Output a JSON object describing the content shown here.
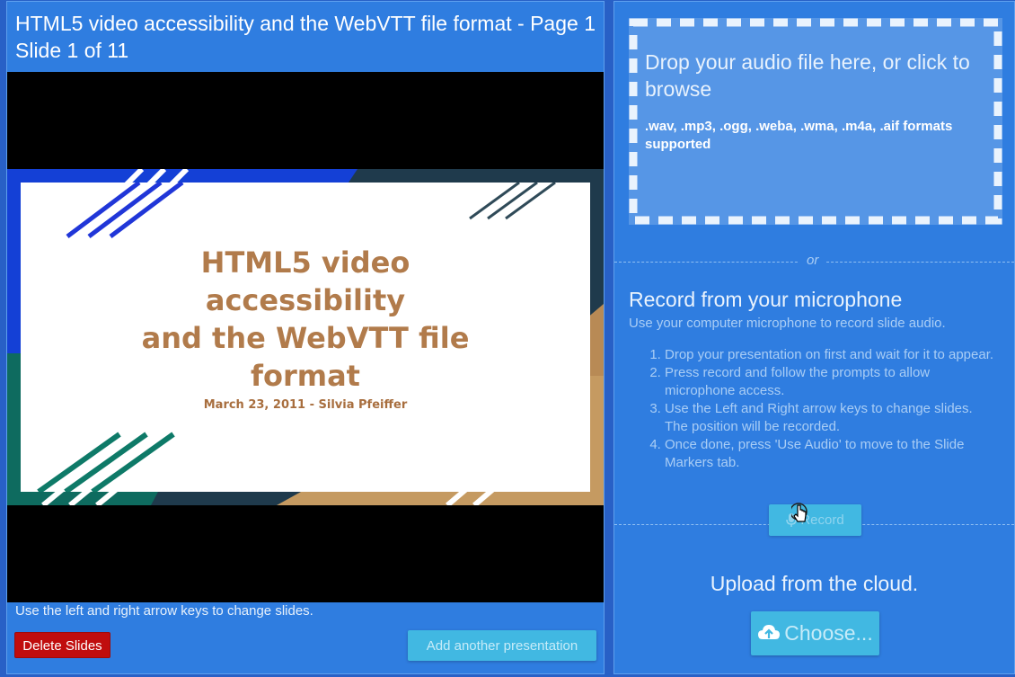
{
  "left": {
    "title": "HTML5 video accessibility and the WebVTT file format - Page 1",
    "counter": "Slide 1 of 11",
    "slide": {
      "heading": "HTML5 video\naccessibility\nand the WebVTT file\nformat",
      "subtitle": "March 23, 2011 - Silvia Pfeiffer"
    },
    "hint": "Use the left and right arrow keys to change slides.",
    "delete_label": "Delete Slides",
    "add_label": "Add another presentation"
  },
  "right": {
    "dropzone": {
      "title": "Drop your audio file here, or click to browse",
      "formats": ".wav, .mp3, .ogg, .weba, .wma, .m4a, .aif formats supported"
    },
    "or_text": "or",
    "record": {
      "title": "Record from your microphone",
      "subtitle": "Use your computer microphone to record slide audio.",
      "steps": [
        "Drop your presentation on first and wait for it to appear.",
        "Press record and follow the prompts to allow microphone access.",
        "Use the Left and Right arrow keys to change slides. The position will be recorded.",
        "Once done, press 'Use Audio' to move to the Slide Markers tab."
      ],
      "button_label": "Record"
    },
    "cloud": {
      "title": "Upload from the cloud.",
      "button_label": "Choose..."
    }
  },
  "icons": {
    "microphone": "microphone-icon",
    "cloud_upload": "cloud-upload-icon",
    "cursor": "hand-cursor-icon"
  },
  "colors": {
    "background": "#2860c6",
    "panel": "#2f7de0",
    "button": "#41b8e2",
    "delete_button": "#c00d0d",
    "slide_text": "#b17b4b"
  }
}
